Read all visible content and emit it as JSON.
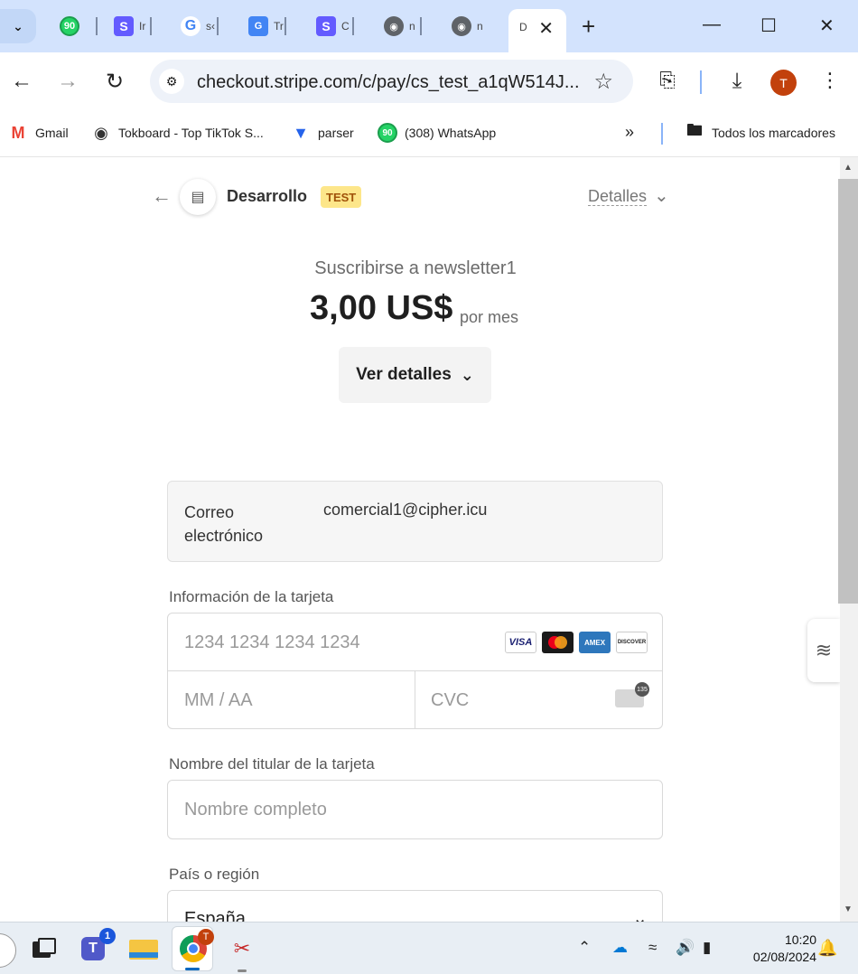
{
  "browser": {
    "tabs": [
      {
        "label": "",
        "icon": "whatsapp-icon",
        "badge": "90"
      },
      {
        "label": "Ir",
        "icon": "stripe-icon"
      },
      {
        "label": "s‹",
        "icon": "google-icon"
      },
      {
        "label": "Tr",
        "icon": "translate-icon"
      },
      {
        "label": "C",
        "icon": "stripe-icon"
      },
      {
        "label": "n",
        "icon": "globe-icon"
      },
      {
        "label": "n",
        "icon": "globe-icon"
      }
    ],
    "active_tab": {
      "label": "D"
    },
    "url": "checkout.stripe.com/c/pay/cs_test_a1qW514J...",
    "profile_initial": "T",
    "bookmarks": [
      {
        "label": "Gmail",
        "icon": "gmail-icon"
      },
      {
        "label": "Tokboard - Top TikTok S...",
        "icon": "globe-icon"
      },
      {
        "label": "parser",
        "icon": "parser-icon"
      },
      {
        "label": "(308) WhatsApp",
        "icon": "whatsapp-icon",
        "badge": "90"
      }
    ],
    "bookmarks_overflow": "»",
    "all_bookmarks": "Todos los marcadores"
  },
  "checkout": {
    "merchant": "Desarrollo",
    "test_badge": "TEST",
    "details_link": "Detalles",
    "product": "Suscribirse a newsletter1",
    "price": "3,00 US$",
    "period": "por mes",
    "view_details": "Ver detalles",
    "email_label": "Correo electrónico",
    "email_value": "comercial1@cipher.icu",
    "card_label": "Información de la tarjeta",
    "card_number_placeholder": "1234 1234 1234 1234",
    "expiry_placeholder": "MM / AA",
    "cvc_placeholder": "CVC",
    "cvc_icon_text": "135",
    "card_brands": [
      "VISA",
      "Mastercard",
      "AMEX",
      "DISCOVER"
    ],
    "name_label": "Nombre del titular de la tarjeta",
    "name_placeholder": "Nombre completo",
    "country_label": "País o región",
    "country_value": "España"
  },
  "taskbar": {
    "teams_badge": "1",
    "chrome_badge": "T",
    "time": "10:20",
    "date": "02/08/2024"
  },
  "colors": {
    "tabstrip": "#d3e3fd",
    "test_badge_bg": "#fde68a",
    "avatar": "#c2410c"
  }
}
